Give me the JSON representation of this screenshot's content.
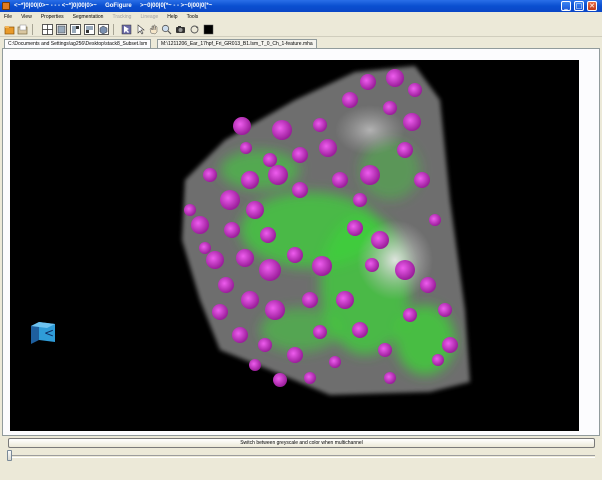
{
  "window": {
    "title": "<~*]0|00|0>~ - - - <~*]0|00|0>~     GoFigure     >~0|00|0[*~ - - >~0|00|0[*~",
    "minimize_glyph": "_",
    "maximize_glyph": "□",
    "close_glyph": "✕"
  },
  "menu": {
    "items": [
      {
        "label": "File",
        "enabled": true
      },
      {
        "label": "View",
        "enabled": true
      },
      {
        "label": "Properties",
        "enabled": true
      },
      {
        "label": "Segmentation",
        "enabled": true
      },
      {
        "label": "Tracking",
        "enabled": false
      },
      {
        "label": "Lineage",
        "enabled": false
      },
      {
        "label": "Help",
        "enabled": true
      },
      {
        "label": "Tools",
        "enabled": true
      }
    ]
  },
  "toolbar": {
    "icons": [
      "open-icon",
      "open-recent-icon",
      "quad-view-icon",
      "xy-view-icon",
      "xz-view-icon",
      "yz-view-icon",
      "3d-view-icon",
      "pointer-icon",
      "pan-hand-icon",
      "zoom-icon",
      "snapshot-icon",
      "background-color-icon"
    ]
  },
  "tabs": [
    {
      "label": "C:\\Documents and Settings\\ag256\\Desktop\\stack8_Subset.lsm",
      "active": true
    },
    {
      "label": "M:\\1211206_Ear_17hpf_Fri_GR013_B1.lsm_T_0_Ch_1-feature.mha",
      "active": false
    }
  ],
  "viewer": {
    "background_color": "#000000",
    "channel_colors": {
      "magenta": "#d63ad6",
      "green": "#3fd13a"
    }
  },
  "orientation_cube": {
    "face_label": "<"
  },
  "bottom": {
    "switch_button_label": "Switch between greyscale and color when multichannel",
    "timepoint_slider_value": 0
  }
}
